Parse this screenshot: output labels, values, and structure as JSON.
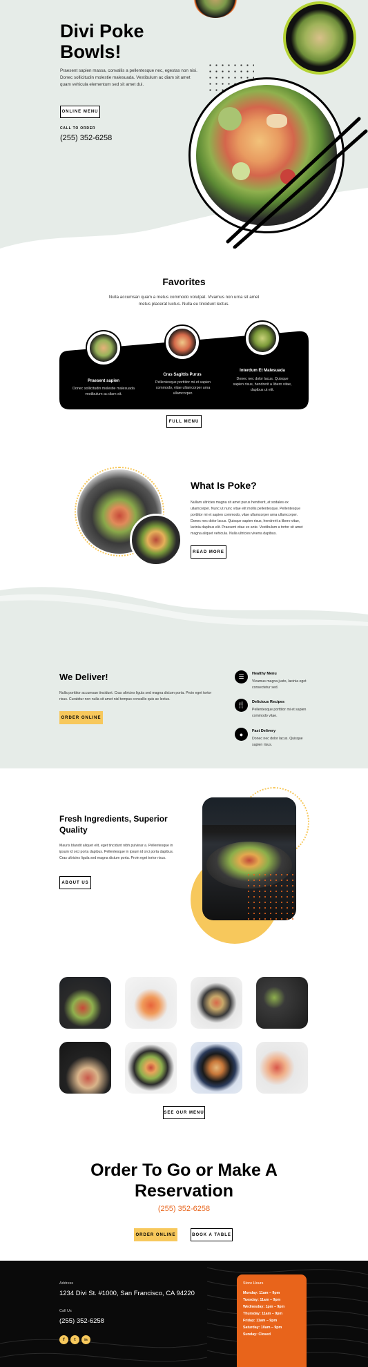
{
  "hero": {
    "title_line1": "Divi Poke",
    "title_line2": "Bowls!",
    "body": "Praesent sapien massa, convallis a pellentesque nec, egestas non nisi. Donec sollicitudin molestie malesuada. Vestibulum ac diam sit amet quam vehicula elementum sed sit amet dui.",
    "button": "ONLINE MENU",
    "call_label": "CALL TO ORDER",
    "phone": "(255) 352-6258"
  },
  "favorites": {
    "title": "Favorites",
    "intro": "Nulla accumsan quam a metus commodo volutpat. Vivamus non urna sit amet metus placerat luctus. Nulla eu tincidunt lectus.",
    "items": [
      {
        "name": "Praesent sapien",
        "desc": "Donec sollicitudin molestie malesuada vestibulum ac diam sit."
      },
      {
        "name": "Cras Sagittis Purus",
        "desc": "Pellentesque porttitor mi et sapien commodo, vitae ullamcorper urna ullamcorper."
      },
      {
        "name": "Interdum Et Malesuada",
        "desc": "Donec nec dolor lacus. Quisque sapien risus, hendrerit a libero vitae, dapibus ut elit."
      }
    ],
    "button": "FULL MENU"
  },
  "what": {
    "title": "What Is Poke?",
    "body": "Nullam ultricies magna sit amet purus hendrerit, at sodales ex ullamcorper. Nunc ut nunc vitae elit mollis pellentesque. Pellentesque porttitor mi et sapien commodo, vitae ullamcorper urna ullamcorper. Donec nec dolor lacus. Quisque sapien risus, hendrerit a libero vitae, lacinia dapibus elit. Praesent vitae ex ante. Vestibulum a tortor sit amet magna aliquet vehicula. Nulla ultricies viverra dapibus.",
    "button": "READ MORE"
  },
  "deliver": {
    "title": "We Deliver!",
    "body": "Nulla porttitor accumsan tincidunt. Cras ultricies ligula sed magna dictum porta. Proin eget tortor risus. Curabitur non nulla sit amet nisl tempus convallis quis ac lectus.",
    "button": "ORDER ONLINE",
    "features": [
      {
        "title": "Healthy Menu",
        "desc": "Vivamus magna justo, lacinia eget consectetur sed."
      },
      {
        "title": "Delicious Recipes",
        "desc": "Pellentesque porttitor mi et sapien commodo vitae."
      },
      {
        "title": "Fast Delivery",
        "desc": "Donec nec dolor lacus. Quisque sapien risus."
      }
    ]
  },
  "fresh": {
    "title_line1": "Fresh Ingredients, Superior",
    "title_line2": "Quality",
    "body": "Mauris blandit aliquet elit, eget tincidunt nibh pulvinar a. Pellentesque in ipsum id orci porta dapibus. Pellentesque in ipsum id orci porta dapibus. Cras ultricies ligula sed magna dictum porta. Proin eget tortor risus.",
    "button": "ABOUT US"
  },
  "gallery": {
    "button": "SEE OUR MENU"
  },
  "order": {
    "title_line1": "Order To Go or Make A",
    "title_line2": "Reservation",
    "phone": "(255) 352-6258",
    "button_order": "ORDER ONLINE",
    "button_book": "BOOK A TABLE"
  },
  "footer": {
    "address_label": "Address",
    "address": "1234 Divi St. #1000, San Francisco, CA 94220",
    "call_label": "Call Us",
    "phone": "(255) 352-6258",
    "social": [
      "f",
      "t",
      "in"
    ],
    "hours_title": "Store Hours",
    "hours": [
      "Monday: 11am – 9pm",
      "Tuesday: 11am – 9pm",
      "Wednesday: 1pm – 9pm",
      "Thursday: 11am – 9pm",
      "Friday: 11am – 9pm",
      "Saturday: 10am – 9pm",
      "Sunday: Closed"
    ]
  },
  "colors": {
    "mint": "#e6ece8",
    "yellow": "#f7c85c",
    "orange": "#e8641b",
    "lime": "#b5d334",
    "black": "#000000"
  }
}
